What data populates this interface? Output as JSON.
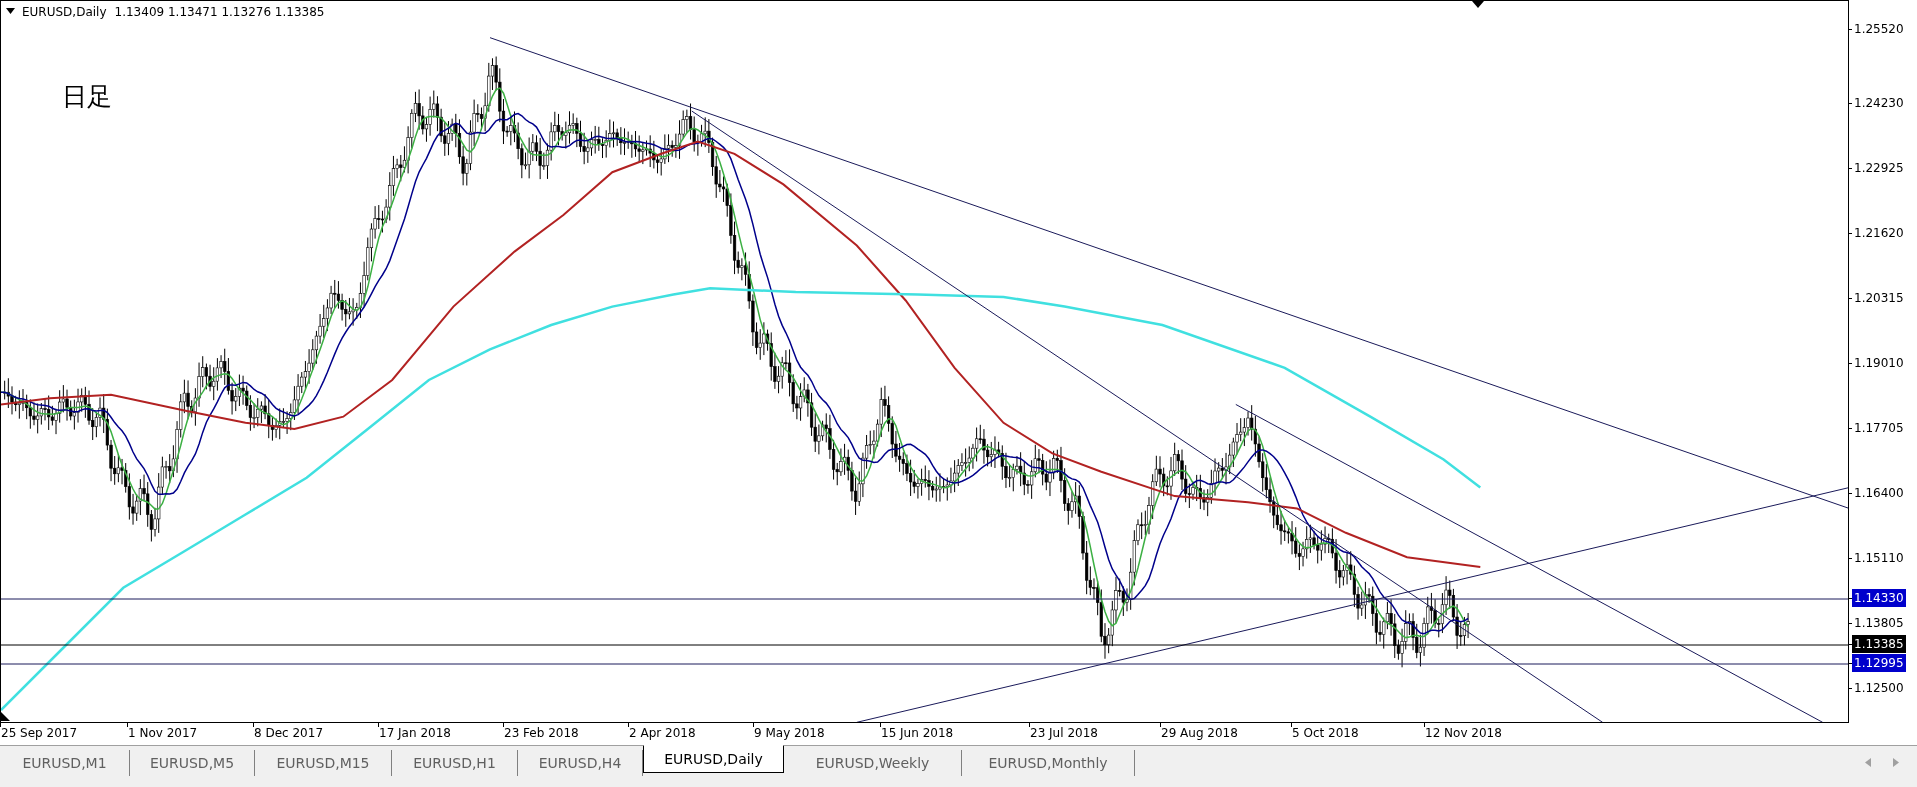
{
  "chart": {
    "title": "EURUSD,Daily",
    "ohlc": "1.13409 1.13471 1.13276 1.13385",
    "label": "日足",
    "price_axis": [
      {
        "text": "1.25520",
        "kind": "tick"
      },
      {
        "text": "1.24230",
        "kind": "tick"
      },
      {
        "text": "1.22925",
        "kind": "tick"
      },
      {
        "text": "1.21620",
        "kind": "tick"
      },
      {
        "text": "1.20315",
        "kind": "tick"
      },
      {
        "text": "1.19010",
        "kind": "tick"
      },
      {
        "text": "1.17705",
        "kind": "tick"
      },
      {
        "text": "1.16400",
        "kind": "tick"
      },
      {
        "text": "1.15110",
        "kind": "tick"
      },
      {
        "text": "1.14330",
        "kind": "level",
        "color": "#0000cc"
      },
      {
        "text": "1.13805",
        "kind": "tick"
      },
      {
        "text": "1.13385",
        "kind": "level",
        "color": "#000000"
      },
      {
        "text": "1.12995",
        "kind": "level",
        "color": "#0000cc"
      },
      {
        "text": "1.12500",
        "kind": "tick"
      }
    ],
    "date_axis": [
      "25 Sep 2017",
      "1 Nov 2017",
      "8 Dec 2017",
      "17 Jan 2018",
      "23 Feb 2018",
      "2 Apr 2018",
      "9 May 2018",
      "15 Jun 2018",
      "23 Jul 2018",
      "29 Aug 2018",
      "5 Oct 2018",
      "12 Nov 2018"
    ]
  },
  "tabs": [
    {
      "label": "EURUSD,M1",
      "selected": false
    },
    {
      "label": "EURUSD,M5",
      "selected": false
    },
    {
      "label": "EURUSD,M15",
      "selected": false
    },
    {
      "label": "EURUSD,H1",
      "selected": false
    },
    {
      "label": "EURUSD,H4",
      "selected": false
    },
    {
      "label": "EURUSD,Daily",
      "selected": true
    },
    {
      "label": "EURUSD,Weekly",
      "selected": false
    },
    {
      "label": "EURUSD,Monthly",
      "selected": false
    }
  ]
}
